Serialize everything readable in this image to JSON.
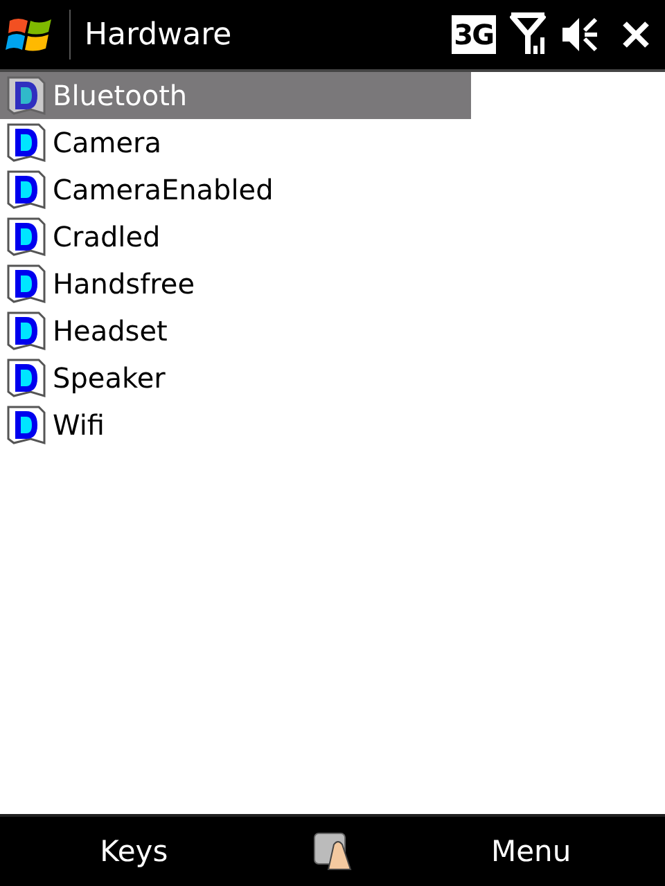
{
  "title_bar": {
    "title": "Hardware",
    "network": "3G"
  },
  "items": [
    {
      "label": "Bluetooth",
      "selected": true
    },
    {
      "label": "Camera",
      "selected": false
    },
    {
      "label": "CameraEnabled",
      "selected": false
    },
    {
      "label": "Cradled",
      "selected": false
    },
    {
      "label": "Handsfree",
      "selected": false
    },
    {
      "label": "Headset",
      "selected": false
    },
    {
      "label": "Speaker",
      "selected": false
    },
    {
      "label": "Wifi",
      "selected": false
    }
  ],
  "softkeys": {
    "left": "Keys",
    "right": "Menu"
  }
}
